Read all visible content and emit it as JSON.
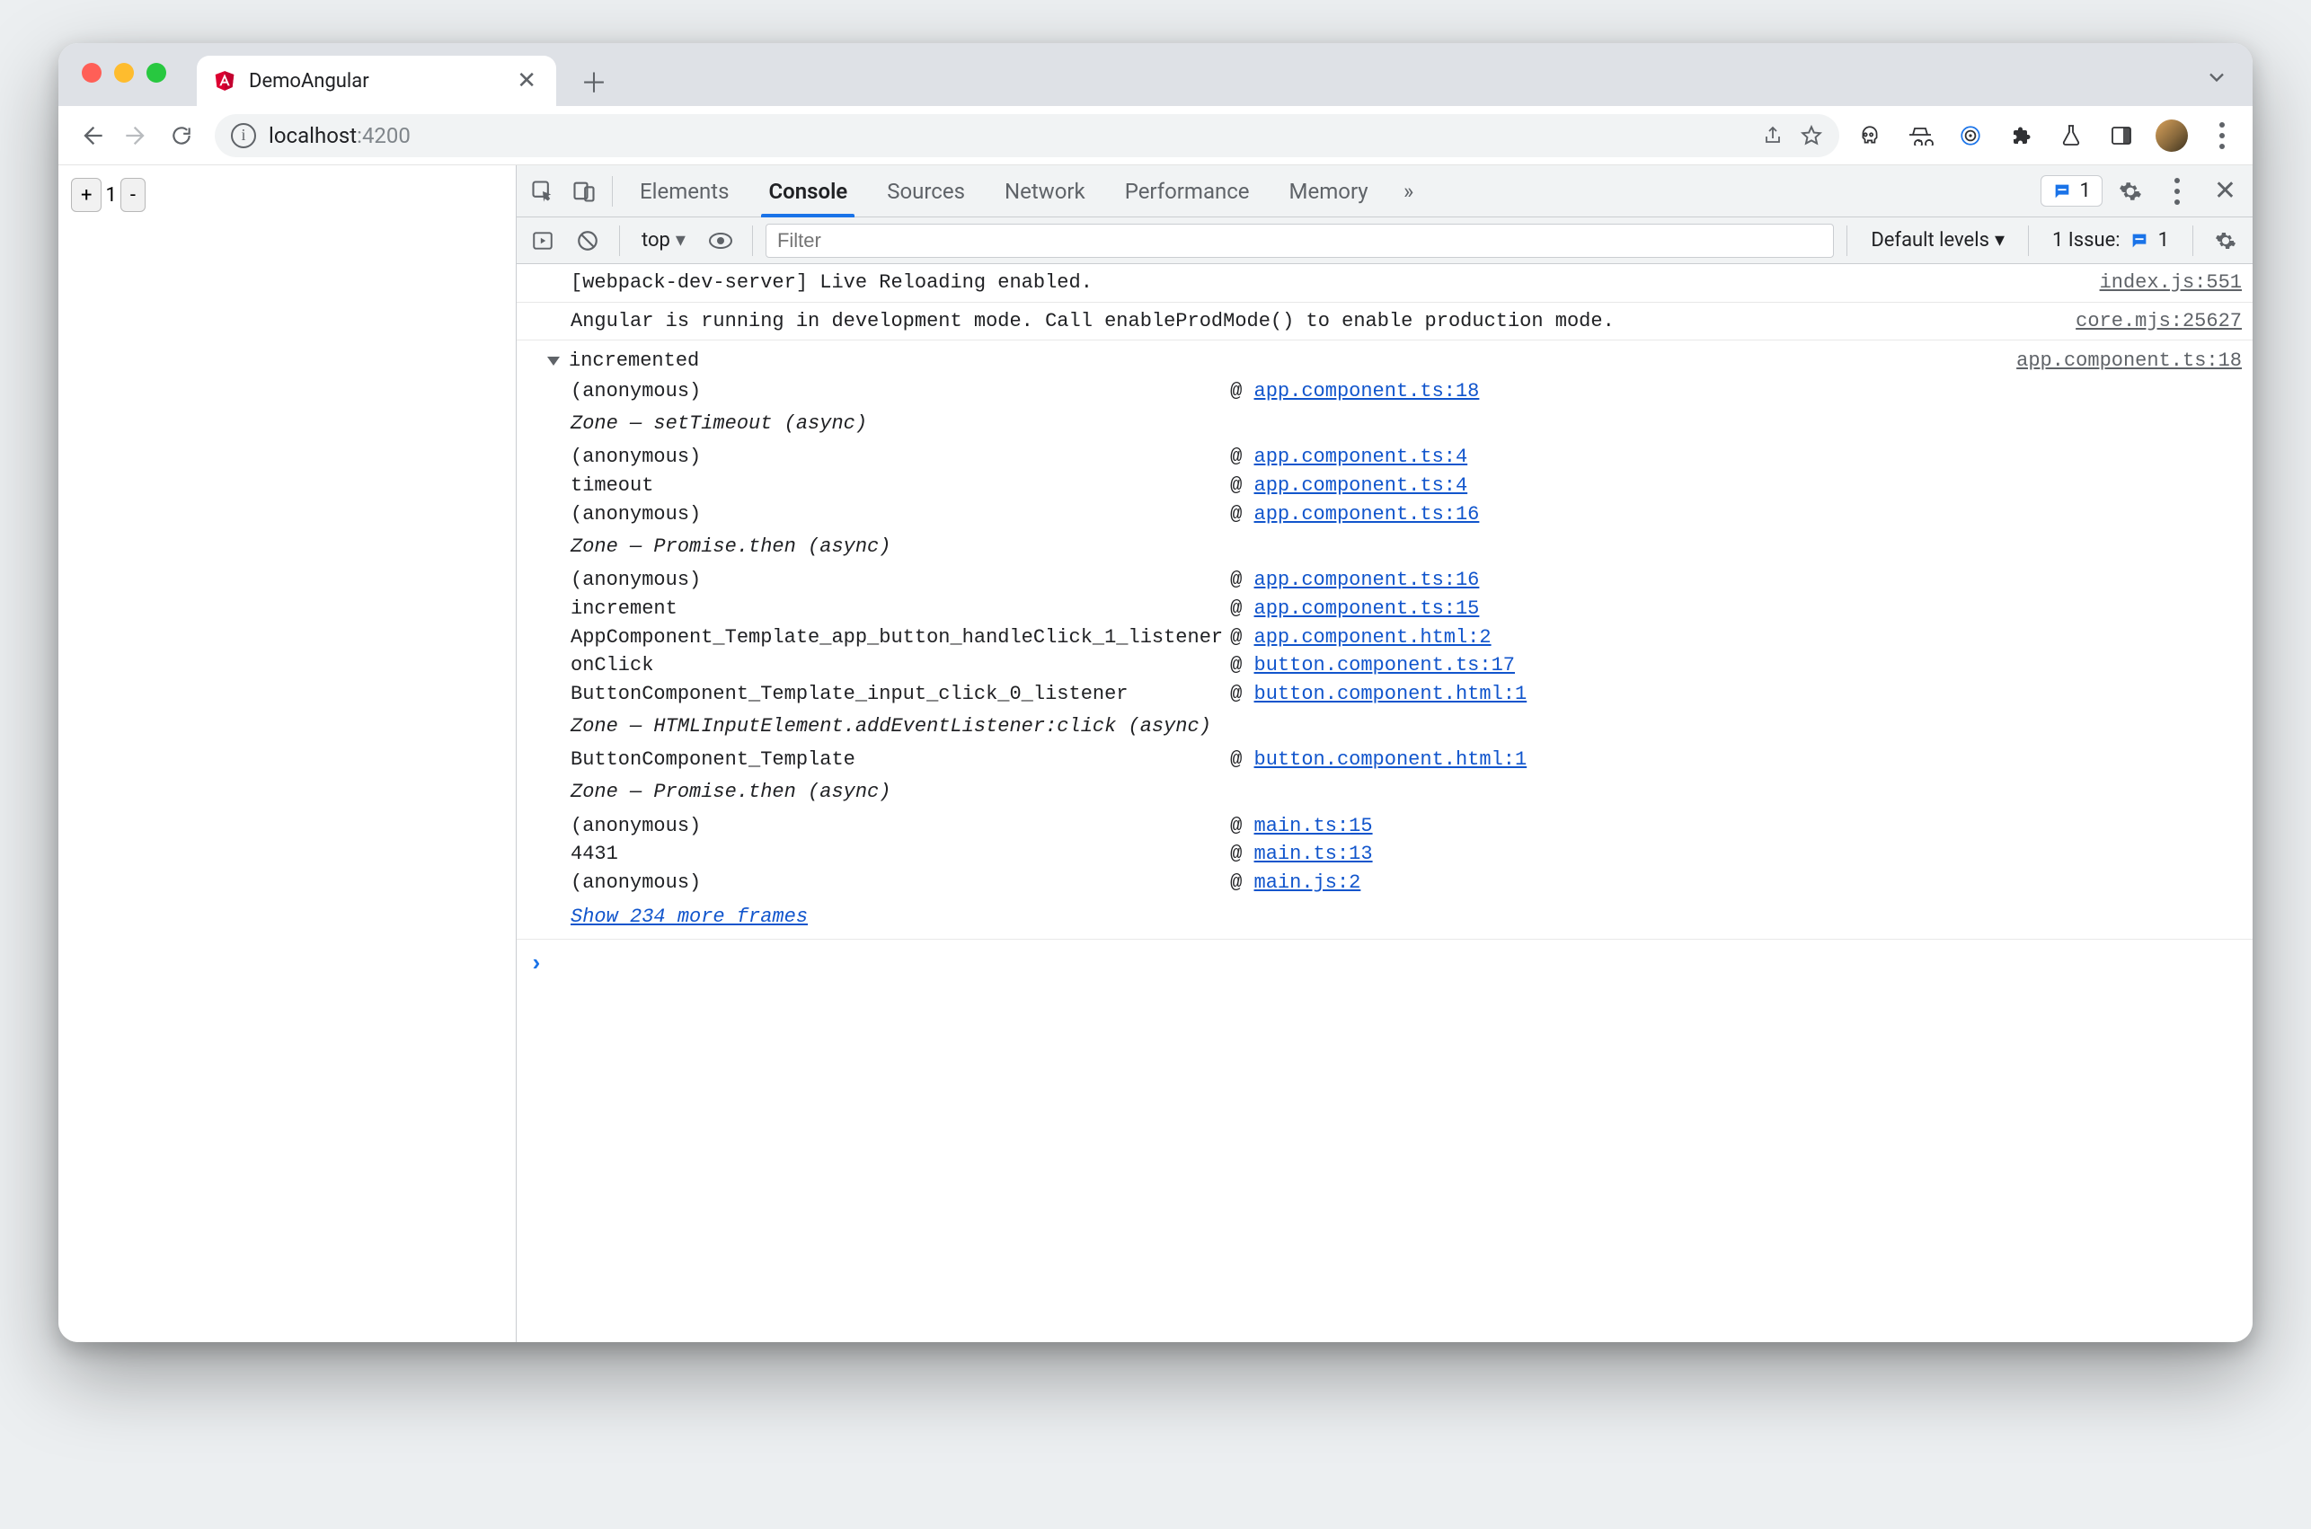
{
  "browser": {
    "tab_title": "DemoAngular",
    "url_host": "localhost",
    "url_port": ":4200"
  },
  "page": {
    "plus_label": "+",
    "counter_value": "1",
    "minus_label": "-"
  },
  "devtools": {
    "tabs": {
      "elements": "Elements",
      "console": "Console",
      "sources": "Sources",
      "network": "Network",
      "performance": "Performance",
      "memory": "Memory"
    },
    "errors_chip_count": "1",
    "subbar": {
      "frame_label": "top",
      "filter_placeholder": "Filter",
      "levels_label": "Default levels",
      "issue_label": "1 Issue:",
      "issue_count": "1"
    },
    "messages": {
      "m1_text": "[webpack-dev-server] Live Reloading enabled.",
      "m1_src": "index.js:551",
      "m2_text": "Angular is running in development mode. Call enableProdMode() to enable production mode.",
      "m2_src": "core.mjs:25627"
    },
    "trace": {
      "header": "incremented",
      "header_src": "app.component.ts:18",
      "frames": [
        {
          "type": "frame",
          "fn": "(anonymous)",
          "at": "@",
          "link": "app.component.ts:18"
        },
        {
          "type": "zone",
          "label": "Zone — setTimeout (async)"
        },
        {
          "type": "frame",
          "fn": "(anonymous)",
          "at": "@",
          "link": "app.component.ts:4"
        },
        {
          "type": "frame",
          "fn": "timeout",
          "at": "@",
          "link": "app.component.ts:4"
        },
        {
          "type": "frame",
          "fn": "(anonymous)",
          "at": "@",
          "link": "app.component.ts:16"
        },
        {
          "type": "zone",
          "label": "Zone — Promise.then (async)"
        },
        {
          "type": "frame",
          "fn": "(anonymous)",
          "at": "@",
          "link": "app.component.ts:16"
        },
        {
          "type": "frame",
          "fn": "increment",
          "at": "@",
          "link": "app.component.ts:15"
        },
        {
          "type": "frame",
          "fn": "AppComponent_Template_app_button_handleClick_1_listener",
          "at": "@",
          "link": "app.component.html:2"
        },
        {
          "type": "frame",
          "fn": "onClick",
          "at": "@",
          "link": "button.component.ts:17"
        },
        {
          "type": "frame",
          "fn": "ButtonComponent_Template_input_click_0_listener",
          "at": "@",
          "link": "button.component.html:1"
        },
        {
          "type": "zone",
          "label": "Zone — HTMLInputElement.addEventListener:click (async)"
        },
        {
          "type": "frame",
          "fn": "ButtonComponent_Template",
          "at": "@",
          "link": "button.component.html:1"
        },
        {
          "type": "zone",
          "label": "Zone — Promise.then (async)"
        },
        {
          "type": "frame",
          "fn": "(anonymous)",
          "at": "@",
          "link": "main.ts:15"
        },
        {
          "type": "frame",
          "fn": "4431",
          "at": "@",
          "link": "main.ts:13"
        },
        {
          "type": "frame",
          "fn": "(anonymous)",
          "at": "@",
          "link": "main.js:2"
        }
      ],
      "more_label": "Show 234 more frames"
    },
    "prompt": "›"
  }
}
